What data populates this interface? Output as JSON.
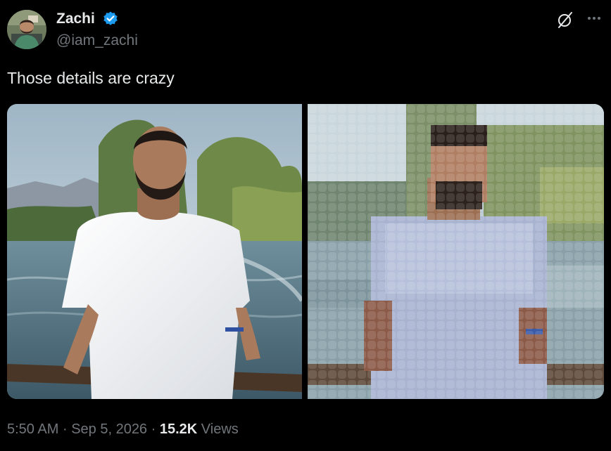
{
  "author": {
    "display_name": "Zachi",
    "handle": "@iam_zachi",
    "verified": true
  },
  "tweet": {
    "text": "Those details are crazy"
  },
  "media": [
    {
      "name": "original-photo"
    },
    {
      "name": "pixelated-photo"
    }
  ],
  "meta": {
    "time": "5:50 AM",
    "separator": "·",
    "date": "Sep 5, 2026",
    "views_count": "15.2K",
    "views_label": "Views"
  },
  "icons": {
    "verified": "verified-badge-icon",
    "grok": "grok-icon",
    "more": "more-options-icon"
  },
  "colors": {
    "background": "#000000",
    "text_primary": "#e7e9ea",
    "text_secondary": "#71767b",
    "verified_blue": "#1d9bf0"
  }
}
